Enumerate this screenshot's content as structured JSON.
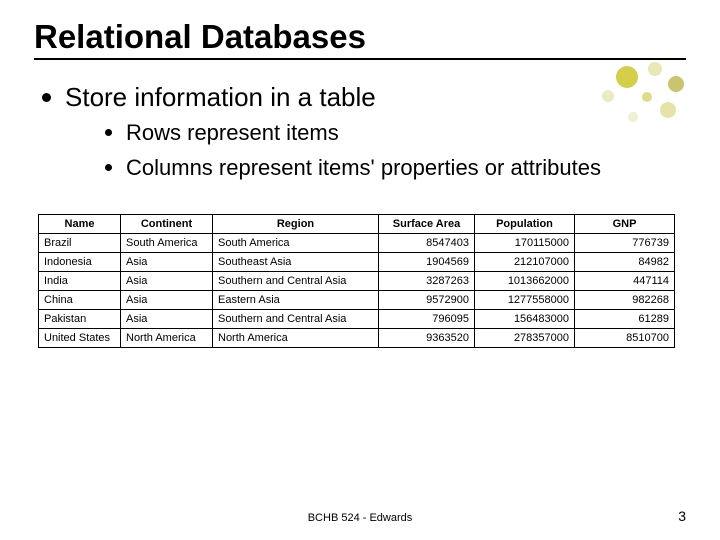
{
  "title": "Relational Databases",
  "bullet1": "Store information in a table",
  "sub1": "Rows represent items",
  "sub2": "Columns represent items' properties or attributes",
  "headers": {
    "name": "Name",
    "continent": "Continent",
    "region": "Region",
    "surface": "Surface Area",
    "population": "Population",
    "gnp": "GNP"
  },
  "rows": [
    {
      "name": "Brazil",
      "continent": "South America",
      "region": "South America",
      "surface": "8547403",
      "population": "170115000",
      "gnp": "776739"
    },
    {
      "name": "Indonesia",
      "continent": "Asia",
      "region": "Southeast Asia",
      "surface": "1904569",
      "population": "212107000",
      "gnp": "84982"
    },
    {
      "name": "India",
      "continent": "Asia",
      "region": "Southern and Central Asia",
      "surface": "3287263",
      "population": "1013662000",
      "gnp": "447114"
    },
    {
      "name": "China",
      "continent": "Asia",
      "region": "Eastern Asia",
      "surface": "9572900",
      "population": "1277558000",
      "gnp": "982268"
    },
    {
      "name": "Pakistan",
      "continent": "Asia",
      "region": "Southern and Central Asia",
      "surface": "796095",
      "population": "156483000",
      "gnp": "61289"
    },
    {
      "name": "United States",
      "continent": "North America",
      "region": "North America",
      "surface": "9363520",
      "population": "278357000",
      "gnp": "8510700"
    }
  ],
  "footer": "BCHB 524 - Edwards",
  "page": "3",
  "chart_data": {
    "type": "table",
    "title": "Relational Databases example table",
    "columns": [
      "Name",
      "Continent",
      "Region",
      "Surface Area",
      "Population",
      "GNP"
    ],
    "data": [
      [
        "Brazil",
        "South America",
        "South America",
        8547403,
        170115000,
        776739
      ],
      [
        "Indonesia",
        "Asia",
        "Southeast Asia",
        1904569,
        212107000,
        84982
      ],
      [
        "India",
        "Asia",
        "Southern and Central Asia",
        3287263,
        1013662000,
        447114
      ],
      [
        "China",
        "Asia",
        "Eastern Asia",
        9572900,
        1277558000,
        982268
      ],
      [
        "Pakistan",
        "Asia",
        "Southern and Central Asia",
        796095,
        156483000,
        61289
      ],
      [
        "United States",
        "North America",
        "North America",
        9363520,
        278357000,
        8510700
      ]
    ]
  }
}
